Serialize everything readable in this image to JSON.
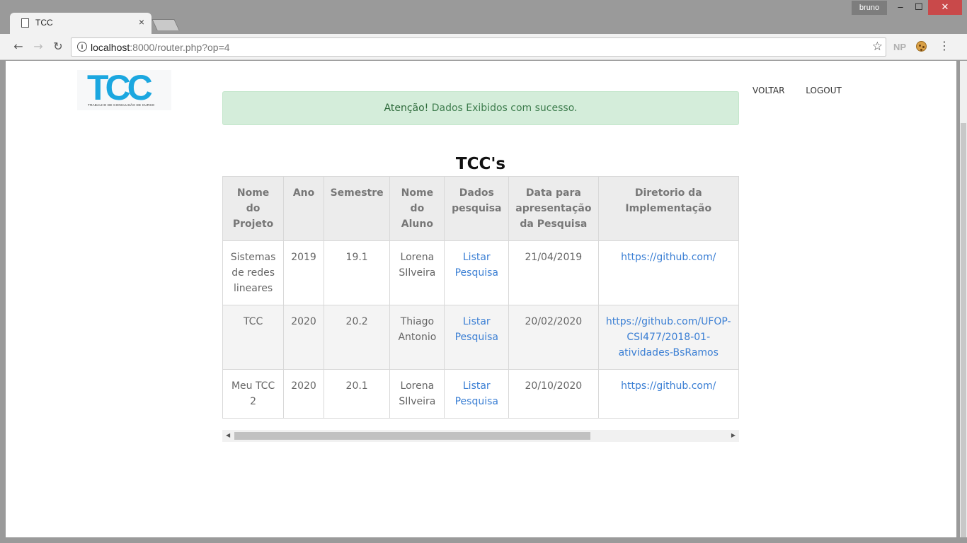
{
  "browser": {
    "tab_title": "TCC",
    "tab_close": "×",
    "user_name": "bruno",
    "url_host": "localhost",
    "url_rest": ":8000/router.php?op=4",
    "ext_np": "NP",
    "window_controls": {
      "minimize": "–",
      "maximize": "☐",
      "close": "✕"
    }
  },
  "logo": {
    "title": "TCC",
    "subtitle": "TRABALHO DE CONCLUSÃO DE CURSO"
  },
  "nav": {
    "back": "VOLTAR",
    "logout": "LOGOUT"
  },
  "alert": {
    "strong": "Atenção!",
    "message": " Dados Exibidos com sucesso."
  },
  "page_title": "TCC's",
  "table": {
    "headers": [
      "Nome do Projeto",
      "Ano",
      "Semestre",
      "Nome do Aluno",
      "Dados pesquisa",
      "Data para apresentação da Pesquisa",
      "Diretorio da Implementação"
    ],
    "rows": [
      {
        "nome": "Sistemas de redes lineares",
        "ano": "2019",
        "semestre": "19.1",
        "aluno": "Lorena SIlveira",
        "dados": "Listar Pesquisa",
        "data": "21/04/2019",
        "diretorio": "https://github.com/"
      },
      {
        "nome": "TCC",
        "ano": "2020",
        "semestre": "20.2",
        "aluno": "Thiago Antonio",
        "dados": "Listar Pesquisa",
        "data": "20/02/2020",
        "diretorio": "https://github.com/UFOP-CSI477/2018-01-atividades-BsRamos"
      },
      {
        "nome": "Meu TCC 2",
        "ano": "2020",
        "semestre": "20.1",
        "aluno": "Lorena SIlveira",
        "dados": "Listar Pesquisa",
        "data": "20/10/2020",
        "diretorio": "https://github.com/"
      }
    ]
  },
  "colors": {
    "link": "#3b7fd4",
    "alert_bg": "#d4edda",
    "logo": "#1ba7e0",
    "close_btn": "#c9494a"
  }
}
